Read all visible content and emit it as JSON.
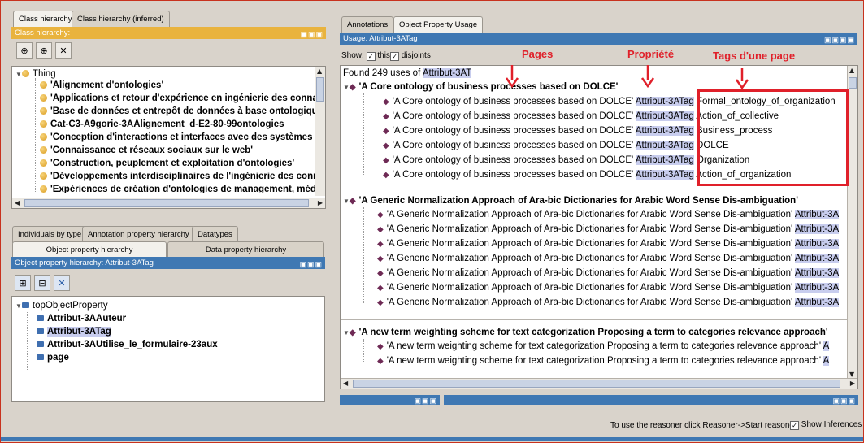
{
  "left_top": {
    "tabs": [
      "Class hierarchy",
      "Class hierarchy (inferred)"
    ],
    "header": "Class hierarchy:",
    "root": "Thing",
    "items": [
      "'Alignement d'ontologies'",
      "'Applications et retour d'expérience en ingénierie des conna",
      "'Base de données et entrepôt de données à base ontologiqu",
      "Cat-C3-A9gorie-3AAlignement_d-E2-80-99ontologies",
      "'Conception d'interactions et interfaces avec des systèmes",
      "'Connaissance et réseaux sociaux sur le web'",
      "'Construction, peuplement et exploitation d'ontologies'",
      "'Développements interdisciplinaires de l'ingénierie des conr",
      "'Expériences de création d'ontologies de management, méd"
    ]
  },
  "left_bottom": {
    "tabs_row1": [
      "Individuals by type",
      "Annotation property hierarchy",
      "Datatypes"
    ],
    "tabs_row2": [
      "Object property hierarchy",
      "Data property hierarchy"
    ],
    "header": "Object property hierarchy: Attribut-3ATag",
    "root": "topObjectProperty",
    "items": [
      "Attribut-3AAuteur",
      "Attribut-3ATag",
      "Attribut-3AUtilise_le_formulaire-23aux",
      "page"
    ]
  },
  "right": {
    "tabs": [
      "Annotations",
      "Object Property Usage"
    ],
    "header": "Usage: Attribut-3ATag",
    "show_label": "Show:",
    "this_label": "this",
    "disjoints_label": "disjoints",
    "found_prefix": "Found 249 uses of ",
    "found_prop": "Attribut-3AT",
    "annotations": {
      "pages": "Pages",
      "propriete": "Propriété",
      "tags": "Tags d'une page"
    },
    "groups": [
      {
        "title": "'A Core ontology of business processes based on DOLCE'",
        "rows": [
          {
            "subject": "'A Core ontology of business processes based on DOLCE'",
            "prop": "Attribut-3ATag",
            "value": "Formal_ontology_of_organization"
          },
          {
            "subject": "'A Core ontology of business processes based on DOLCE'",
            "prop": "Attribut-3ATag",
            "value": "Action_of_collective"
          },
          {
            "subject": "'A Core ontology of business processes based on DOLCE'",
            "prop": "Attribut-3ATag",
            "value": "Business_process"
          },
          {
            "subject": "'A Core ontology of business processes based on DOLCE'",
            "prop": "Attribut-3ATag",
            "value": "DOLCE"
          },
          {
            "subject": "'A Core ontology of business processes based on DOLCE'",
            "prop": "Attribut-3ATag",
            "value": "Organization"
          },
          {
            "subject": "'A Core ontology of business processes based on DOLCE'",
            "prop": "Attribut-3ATag",
            "value": "Action_of_organization"
          }
        ]
      },
      {
        "title": "'A Generic Normalization Approach of Ara-bic Dictionaries for Arabic Word Sense Dis-ambiguation'",
        "rows": [
          {
            "subject": "'A Generic Normalization Approach of Ara-bic Dictionaries for Arabic Word Sense Dis-ambiguation'",
            "prop": "Attribut-3A"
          },
          {
            "subject": "'A Generic Normalization Approach of Ara-bic Dictionaries for Arabic Word Sense Dis-ambiguation'",
            "prop": "Attribut-3A"
          },
          {
            "subject": "'A Generic Normalization Approach of Ara-bic Dictionaries for Arabic Word Sense Dis-ambiguation'",
            "prop": "Attribut-3A"
          },
          {
            "subject": "'A Generic Normalization Approach of Ara-bic Dictionaries for Arabic Word Sense Dis-ambiguation'",
            "prop": "Attribut-3A"
          },
          {
            "subject": "'A Generic Normalization Approach of Ara-bic Dictionaries for Arabic Word Sense Dis-ambiguation'",
            "prop": "Attribut-3A"
          },
          {
            "subject": "'A Generic Normalization Approach of Ara-bic Dictionaries for Arabic Word Sense Dis-ambiguation'",
            "prop": "Attribut-3A"
          },
          {
            "subject": "'A Generic Normalization Approach of Ara-bic Dictionaries for Arabic Word Sense Dis-ambiguation'",
            "prop": "Attribut-3A"
          }
        ]
      },
      {
        "title": "'A new term weighting scheme for text categorization Proposing a term to categories relevance approach'",
        "rows": [
          {
            "subject": "'A new term weighting scheme for text categorization Proposing a term to categories relevance approach'",
            "prop": "A"
          },
          {
            "subject": "'A new term weighting scheme for text categorization Proposing a term to categories relevance approach'",
            "prop": "A"
          }
        ]
      }
    ]
  },
  "status_bar": {
    "reasoner_hint": "To use the reasoner click Reasoner->Start reasoner",
    "show_inferences": "Show Inferences"
  },
  "colors": {
    "accent_orange": "#e9b33e",
    "accent_blue": "#3f78b3",
    "highlight": "#c8cdee",
    "annotation_red": "#e0202a"
  }
}
